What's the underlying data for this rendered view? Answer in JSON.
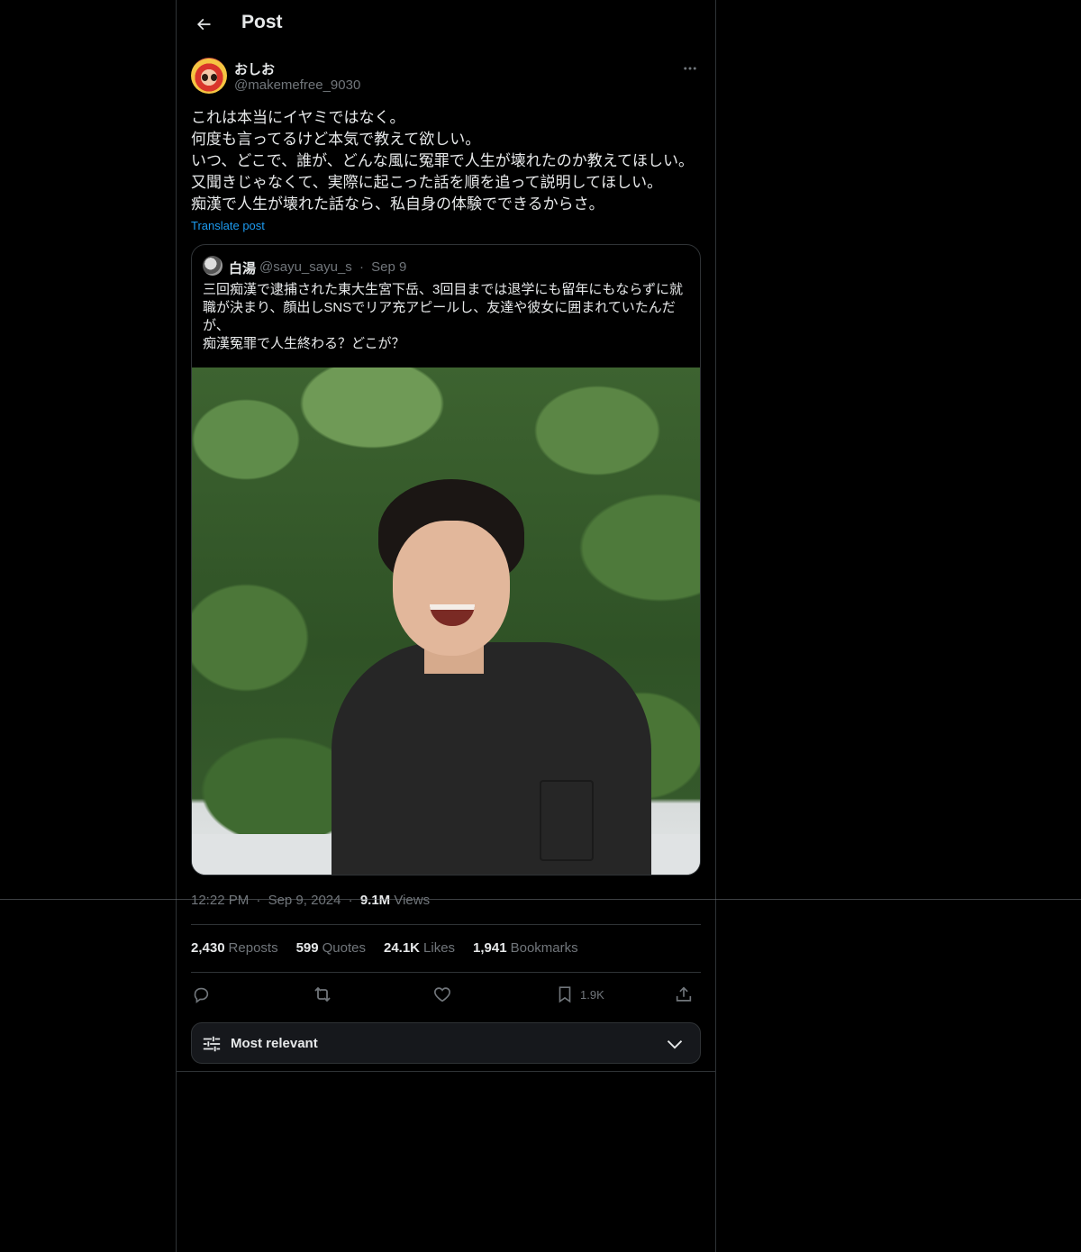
{
  "header": {
    "title": "Post",
    "back_icon": "arrow-left-icon"
  },
  "author": {
    "display_name": "おしお",
    "handle": "@makemefree_9030",
    "more_icon": "ellipsis-icon"
  },
  "post": {
    "text": "これは本当にイヤミではなく。\n何度も言ってるけど本気で教えて欲しい。\nいつ、どこで、誰が、どんな風に冤罪で人生が壊れたのか教えてほしい。\n又聞きじゃなくて、実際に起こった話を順を追って説明してほしい。\n痴漢で人生が壊れた話なら、私自身の体験でできるからさ。",
    "translate_label": "Translate post"
  },
  "quote": {
    "name": "白湯",
    "handle": "@sayu_sayu_s",
    "separator": "·",
    "date": "Sep 9",
    "text": "三回痴漢で逮捕された東大生宮下岳、3回目までは退学にも留年にもならずに就職が決まり、顔出しSNSでリア充アピールし、友達や彼女に囲まれていたんだが、\n痴漢冤罪で人生終わる？どこが？"
  },
  "meta": {
    "time": "12:22 PM",
    "separator": "·",
    "date": "Sep 9, 2024",
    "views_num": "9.1M",
    "views_label": "Views"
  },
  "stats": [
    {
      "num": "2,430",
      "label": "Reposts"
    },
    {
      "num": "599",
      "label": "Quotes"
    },
    {
      "num": "24.1K",
      "label": "Likes"
    },
    {
      "num": "1,941",
      "label": "Bookmarks"
    }
  ],
  "actions": {
    "reply_icon": "reply-icon",
    "repost_icon": "repost-icon",
    "like_icon": "heart-icon",
    "bookmark_icon": "bookmark-icon",
    "bookmark_count": "1.9K",
    "share_icon": "share-icon"
  },
  "sort": {
    "label": "Most relevant",
    "icon": "sliders-icon",
    "chevron": "chevron-down-icon"
  },
  "colors": {
    "background": "#000000",
    "text": "#e7e9ea",
    "muted": "#71767b",
    "accent": "#1d9bf0",
    "border": "#2f3336"
  }
}
